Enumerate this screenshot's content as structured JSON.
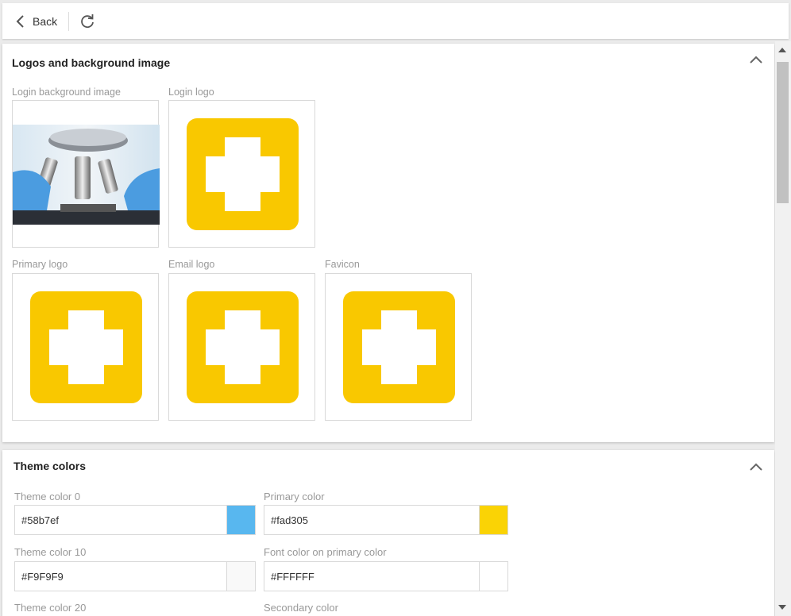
{
  "toolbar": {
    "back_label": "Back",
    "icons": {
      "back": "chevron-left-icon",
      "refresh": "refresh-icon"
    }
  },
  "logos_section": {
    "title": "Logos and background image",
    "items": [
      {
        "label": "Login background image",
        "image": "microscope-photo"
      },
      {
        "label": "Login logo",
        "image": "yellow-cross-logo"
      },
      {
        "label": "Primary logo",
        "image": "yellow-cross-logo"
      },
      {
        "label": "Email logo",
        "image": "yellow-cross-logo"
      },
      {
        "label": "Favicon",
        "image": "yellow-cross-logo"
      }
    ]
  },
  "colors_section": {
    "title": "Theme colors",
    "fields": [
      {
        "label": "Theme color 0",
        "value": "#58b7ef",
        "swatch": "#58b7ef"
      },
      {
        "label": "Primary color",
        "value": "#fad305",
        "swatch": "#fad305"
      },
      {
        "label": "Theme color 10",
        "value": "#F9F9F9",
        "swatch": "#F9F9F9"
      },
      {
        "label": "Font color on primary color",
        "value": "#FFFFFF",
        "swatch": "#FFFFFF"
      },
      {
        "label": "Theme color 20"
      },
      {
        "label": "Secondary color"
      }
    ]
  },
  "colors": {
    "logo_yellow": "#f9c800",
    "background": "#ebebeb"
  }
}
